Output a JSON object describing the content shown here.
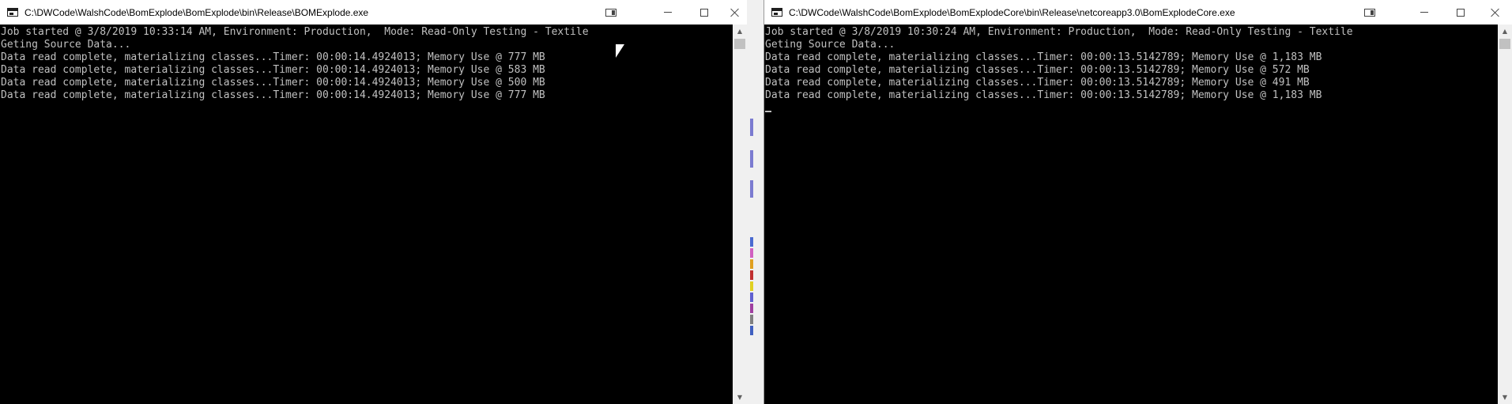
{
  "left_window": {
    "title": "C:\\DWCode\\WalshCode\\BomExplode\\BomExplode\\bin\\Release\\BOMExplode.exe",
    "lines": [
      "Job started @ 3/8/2019 10:33:14 AM, Environment: Production,  Mode: Read-Only Testing - Textile",
      "Geting Source Data...",
      "Data read complete, materializing classes...Timer: 00:00:14.4924013; Memory Use @ 777 MB",
      "Data read complete, materializing classes...Timer: 00:00:14.4924013; Memory Use @ 583 MB",
      "Data read complete, materializing classes...Timer: 00:00:14.4924013; Memory Use @ 500 MB",
      "Data read complete, materializing classes...Timer: 00:00:14.4924013; Memory Use @ 777 MB"
    ]
  },
  "right_window": {
    "title": "C:\\DWCode\\WalshCode\\BomExplode\\BomExplodeCore\\bin\\Release\\netcoreapp3.0\\BomExplodeCore.exe",
    "lines": [
      "Job started @ 3/8/2019 10:30:24 AM, Environment: Production,  Mode: Read-Only Testing - Textile",
      "Geting Source Data...",
      "Data read complete, materializing classes...Timer: 00:00:13.5142789; Memory Use @ 1,183 MB",
      "Data read complete, materializing classes...Timer: 00:00:13.5142789; Memory Use @ 572 MB",
      "Data read complete, materializing classes...Timer: 00:00:13.5142789; Memory Use @ 491 MB",
      "Data read complete, materializing classes...Timer: 00:00:13.5142789; Memory Use @ 1,183 MB"
    ]
  },
  "icons": {
    "app": "console-app-icon",
    "snap": "snap-layout-icon",
    "minimize": "minimize-icon",
    "maximize": "maximize-icon",
    "close": "close-icon",
    "pointer": "mouse-pointer-icon"
  },
  "colors": {
    "console_background": "#000000",
    "console_text": "#c0c0c0",
    "titlebar_background": "#ffffff",
    "scrollbar_background": "#f0f0f0"
  }
}
